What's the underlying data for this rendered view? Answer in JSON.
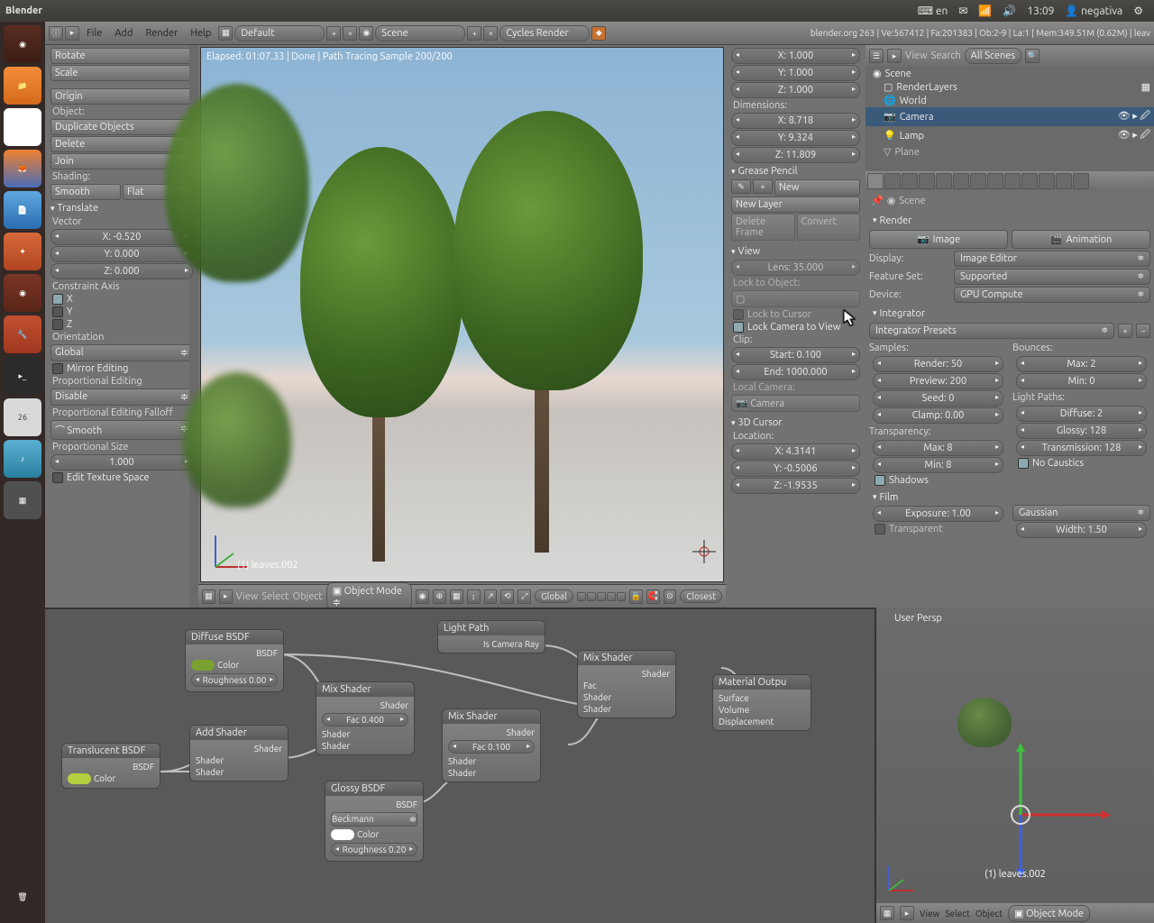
{
  "ubuntu": {
    "app": "Blender",
    "lang": "en",
    "time": "13:09",
    "user": "negativa"
  },
  "infobar": {
    "menus": [
      "File",
      "Add",
      "Render",
      "Help"
    ],
    "layout": "Default",
    "scene": "Scene",
    "engine": "Cycles Render",
    "stats": "blender.org 263 | Ve:567412 | Fa:201383 | Ob:2-9 | La:1 | Mem:349.51M (0.62M) | leav"
  },
  "tools": {
    "rotate": "Rotate",
    "scale": "Scale",
    "origin": "Origin",
    "object_lbl": "Object:",
    "dup": "Duplicate Objects",
    "delete": "Delete",
    "join": "Join",
    "shading_lbl": "Shading:",
    "smooth": "Smooth",
    "flat": "Flat",
    "translate": "Translate",
    "vector_lbl": "Vector",
    "vx": "X: -0.520",
    "vy": "Y: 0.000",
    "vz": "Z: 0.000",
    "constraint": "Constraint Axis",
    "cx": "X",
    "cy": "Y",
    "cz": "Z",
    "orientation": "Orientation",
    "global": "Global",
    "mirror": "Mirror Editing",
    "proped": "Proportional Editing",
    "disable": "Disable",
    "falloff": "Proportional Editing Falloff",
    "smooth2": "Smooth",
    "propsize": "Proportional Size",
    "size": "1.000",
    "edittex": "Edit Texture Space"
  },
  "viewport": {
    "status": "Elapsed: 01:07.33 | Done | Path Tracing Sample 200/200",
    "objlabel": "(1) leaves.002",
    "hdr": {
      "view": "View",
      "select": "Select",
      "object": "Object",
      "mode": "Object Mode",
      "orient": "Global",
      "snap": "Closest"
    }
  },
  "npanel": {
    "tx": "X: 1.000",
    "ty": "Y: 1.000",
    "tz": "Z: 1.000",
    "dim": "Dimensions:",
    "dx": "X: 8.718",
    "dy": "Y: 9.324",
    "dz": "Z: 11.809",
    "gp": "Grease Pencil",
    "new": "New",
    "newlayer": "New Layer",
    "delframe": "Delete Frame",
    "convert": "Convert",
    "view": "View",
    "lens": "Lens: 35.000",
    "lock2obj": "Lock to Object:",
    "lock2cur": "Lock to Cursor",
    "lockcam": "Lock Camera to View",
    "clip": "Clip:",
    "start": "Start: 0.100",
    "end": "End: 1000.000",
    "localcam": "Local Camera:",
    "camera": "Camera",
    "cursor": "3D Cursor",
    "loc": "Location:",
    "cx": "X: 4.3141",
    "cy": "Y: -0.5006",
    "cz": "Z: -1.9535"
  },
  "outliner": {
    "view": "View",
    "search": "Search",
    "type": "All Scenes",
    "items": [
      "Scene",
      "RenderLayers",
      "World",
      "Camera",
      "Lamp",
      "Plane"
    ]
  },
  "props": {
    "scene": "Scene",
    "render": "Render",
    "image": "Image",
    "anim": "Animation",
    "display": "Display:",
    "editor": "Image Editor",
    "feat": "Feature Set:",
    "supported": "Supported",
    "device": "Device:",
    "gpu": "GPU Compute",
    "integrator": "Integrator",
    "presets": "Integrator Presets",
    "samples": "Samples:",
    "rend": "Render: 50",
    "prev": "Preview: 200",
    "seed": "Seed: 0",
    "clamp": "Clamp: 0.00",
    "bounces": "Bounces:",
    "max": "Max: 2",
    "min": "Min: 0",
    "lightpaths": "Light Paths:",
    "diffuse": "Diffuse: 2",
    "glossy": "Glossy: 128",
    "trans": "Transmission: 128",
    "transparency": "Transparency:",
    "tmax": "Max: 8",
    "tmin": "Min: 8",
    "nocaustics": "No Caustics",
    "shadows": "Shadows",
    "film": "Film",
    "exposure": "Exposure: 1.00",
    "gaussian": "Gaussian",
    "transparent": "Transparent",
    "width": "Width: 1.50"
  },
  "nodes": {
    "diffuse": {
      "t": "Diffuse BSDF",
      "bsdf": "BSDF",
      "color": "Color",
      "rough": "Roughness 0.00"
    },
    "trans": {
      "t": "Translucent BSDF",
      "bsdf": "BSDF",
      "color": "Color"
    },
    "add": {
      "t": "Add Shader",
      "shader": "Shader"
    },
    "mix1": {
      "t": "Mix Shader",
      "fac": "Fac 0.400",
      "shader": "Shader"
    },
    "glossy": {
      "t": "Glossy BSDF",
      "bsdf": "BSDF",
      "beck": "Beckmann",
      "color": "Color",
      "rough": "Roughness 0.20"
    },
    "mix2": {
      "t": "Mix Shader",
      "fac": "Fac 0.100",
      "shader": "Shader"
    },
    "light": {
      "t": "Light Path",
      "cam": "Is Camera Ray"
    },
    "mix3": {
      "t": "Mix Shader",
      "fac": "Fac",
      "shader": "Shader"
    },
    "out": {
      "t": "Material Outpu",
      "surf": "Surface",
      "vol": "Volume",
      "disp": "Displacement"
    }
  },
  "miniview": {
    "persp": "User Persp",
    "obj": "(1) leaves.002",
    "view": "View",
    "select": "Select",
    "object": "Object",
    "mode": "Object Mode"
  }
}
